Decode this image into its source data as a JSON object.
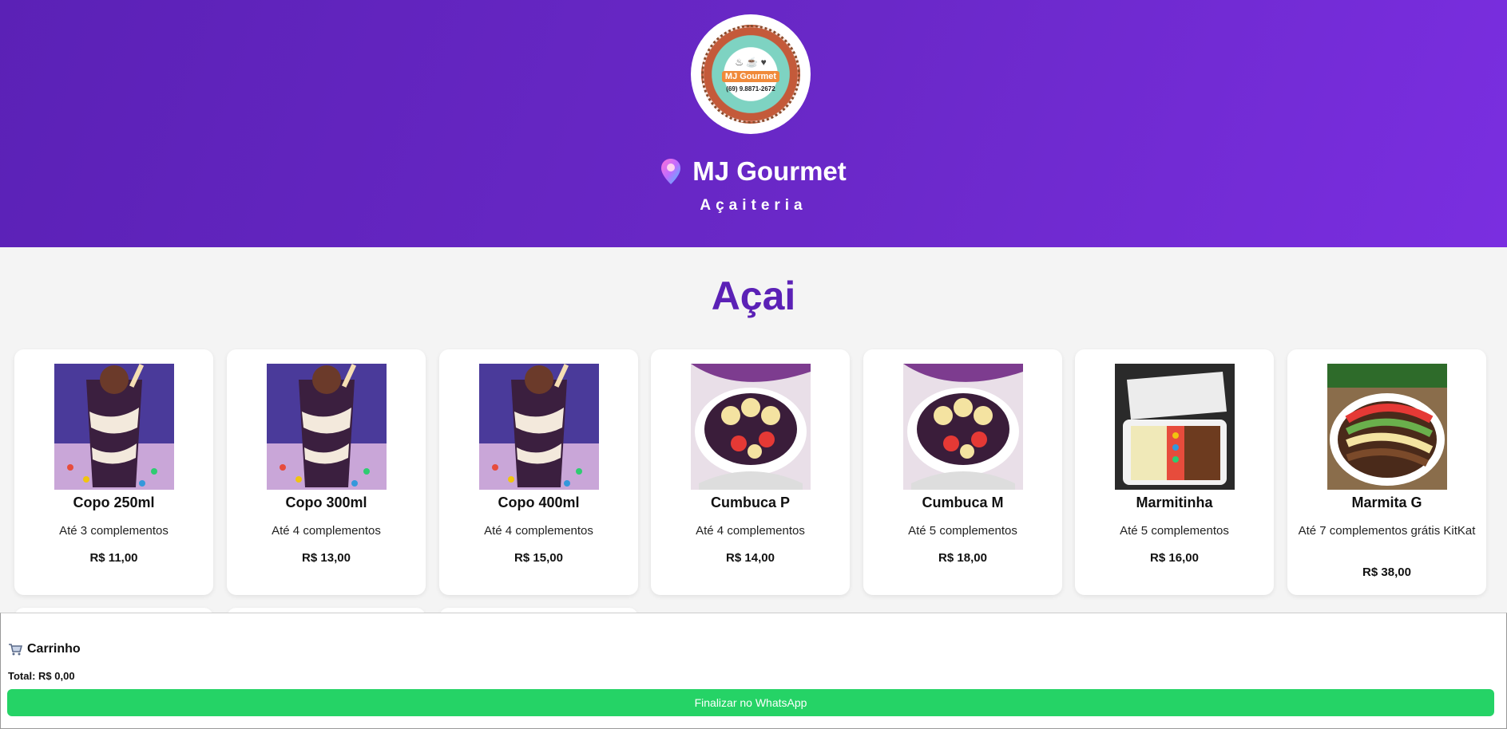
{
  "header": {
    "brand": "MJ Gourmet",
    "subtitle": "Açaiteria",
    "logo": {
      "name": "MJ Gourmet",
      "phone": "(69) 9.8871-2672"
    },
    "gradient": [
      "#5b21b6",
      "#7a2ee0"
    ]
  },
  "section": {
    "title": "Açai"
  },
  "products": [
    {
      "name": "Copo 250ml",
      "desc": "Até 3 complementos",
      "price": "R$ 11,00",
      "image": "cup"
    },
    {
      "name": "Copo 300ml",
      "desc": "Até 4 complementos",
      "price": "R$ 13,00",
      "image": "cup"
    },
    {
      "name": "Copo 400ml",
      "desc": "Até 4 complementos",
      "price": "R$ 15,00",
      "image": "cup"
    },
    {
      "name": "Cumbuca P",
      "desc": "Até 4 complementos",
      "price": "R$ 14,00",
      "image": "bowl"
    },
    {
      "name": "Cumbuca M",
      "desc": "Até 5 complementos",
      "price": "R$ 18,00",
      "image": "bowl"
    },
    {
      "name": "Marmitinha",
      "desc": "Até 5 complementos",
      "price": "R$ 16,00",
      "image": "box"
    },
    {
      "name": "Marmita G",
      "desc": "Até 7 complementos grátis KitKat",
      "price": "R$ 38,00",
      "image": "platter"
    }
  ],
  "cart": {
    "icon": "cart-icon",
    "title": "Carrinho",
    "total": "Total: R$ 0,00",
    "checkout_label": "Finalizar no WhatsApp",
    "checkout_color": "#25d366"
  },
  "accent": "#5b21b6"
}
